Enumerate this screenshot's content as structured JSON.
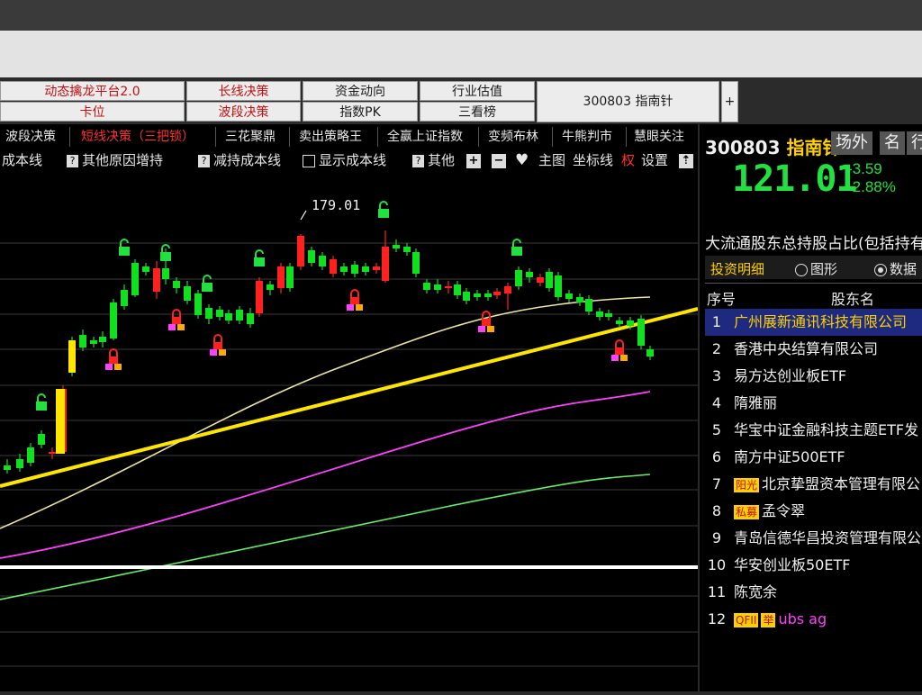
{
  "menu": {
    "row1": [
      "动态擒龙平台2.0",
      "长线决策",
      "资金动向",
      "行业估值"
    ],
    "row2": [
      "卡位",
      "波段决策",
      "指数PK",
      "三看榜"
    ],
    "stock_button": "300803 指南针",
    "plus": "+"
  },
  "tabs": [
    "波段决策",
    "短线决策（三把锁）",
    "三花聚鼎",
    "卖出策略王",
    "全赢上证指数",
    "变频布林",
    "牛熊判市",
    "慧眼关注"
  ],
  "active_tab_index": 1,
  "options": {
    "cost_line": "成本线",
    "other_increase": "其他原因增持",
    "reduce_cost": "减持成本线",
    "show_cost": "显示成本线",
    "other": "其他",
    "main_chart": "主图",
    "coord_line": "坐标线",
    "right": "权",
    "settings": "设置"
  },
  "chart": {
    "high_label": "179.01"
  },
  "quote": {
    "code": "300803",
    "name": "指南针",
    "btn_off_market": "场外",
    "btn_name": "名",
    "btn_row": "行",
    "price": "121.01",
    "change": "-3.59",
    "change_pct": "-2.88%"
  },
  "holders": {
    "title": "大流通股东总持股占比(包括持有",
    "tab_detail": "投资明细",
    "radio_graph": "图形",
    "radio_data": "数据",
    "col_no": "序号",
    "col_name": "股东名",
    "rows": [
      {
        "no": "1",
        "name": "广州展新通讯科技有限公司",
        "tags": []
      },
      {
        "no": "2",
        "name": "香港中央结算有限公司",
        "tags": []
      },
      {
        "no": "3",
        "name": "易方达创业板ETF",
        "tags": []
      },
      {
        "no": "4",
        "name": "隋雅丽",
        "tags": []
      },
      {
        "no": "5",
        "name": "华宝中证金融科技主题ETF发",
        "tags": []
      },
      {
        "no": "6",
        "name": "南方中证500ETF",
        "tags": []
      },
      {
        "no": "7",
        "name": "北京挚盟资本管理有限公",
        "tags": [
          "阳光"
        ]
      },
      {
        "no": "8",
        "name": "孟令翠",
        "tags": [
          "私募"
        ]
      },
      {
        "no": "9",
        "name": "青岛信德华昌投资管理有限公",
        "tags": []
      },
      {
        "no": "10",
        "name": "华安创业板50ETF",
        "tags": []
      },
      {
        "no": "11",
        "name": "陈宽余",
        "tags": []
      },
      {
        "no": "12",
        "name": "ubs ag",
        "tags": [
          "QFII",
          "举"
        ]
      }
    ]
  },
  "colors": {
    "up": "#ff2020",
    "down": "#10e020",
    "trend": "#ffe600",
    "ma_short": "#efe6a0",
    "ma_mid": "#ff40ff",
    "ma_long": "#66ee66"
  }
}
